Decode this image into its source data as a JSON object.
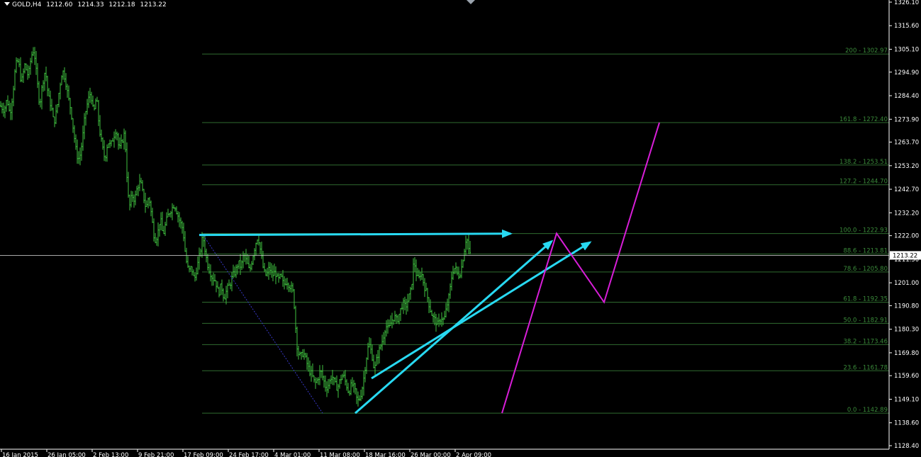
{
  "header": {
    "symbol": "GOLD,H4",
    "open": "1212.60",
    "high": "1214.33",
    "low": "1212.18",
    "close": "1213.22"
  },
  "current_price_label": "1213.22",
  "colors": {
    "background": "#000000",
    "axis": "#ffffff",
    "candles": "#3fc23f",
    "fib": "#2f6b2f",
    "fib_text": "#3a8a3a",
    "arrows": "#28d9f2",
    "projection": "#d81ed8",
    "trend_dotted": "#3838c8",
    "current_line": "#c0c0c0"
  },
  "chart_data": {
    "type": "candlestick",
    "y_axis": {
      "ylim": [
        1124.9,
        1328.8
      ],
      "ticks": [
        "1326.10",
        "1315.60",
        "1305.10",
        "1294.90",
        "1284.40",
        "1273.90",
        "1263.70",
        "1253.20",
        "1242.70",
        "1232.20",
        "1222.00",
        "1211.50",
        "1201.00",
        "1190.80",
        "1180.30",
        "1169.80",
        "1159.60",
        "1149.10",
        "1138.60",
        "1128.40"
      ]
    },
    "x_axis": {
      "ticks": [
        "16 Jan 2015",
        "26 Jan 05:00",
        "2 Feb 13:00",
        "9 Feb 21:00",
        "17 Feb 09:00",
        "24 Feb 17:00",
        "4 Mar 01:00",
        "11 Mar 08:00",
        "18 Mar 16:00",
        "26 Mar 00:00",
        "2 Apr 09:00"
      ]
    },
    "price_path": [
      [
        0,
        1280
      ],
      [
        6,
        1278
      ],
      [
        10,
        1283
      ],
      [
        14,
        1276
      ],
      [
        18,
        1285
      ],
      [
        22,
        1298
      ],
      [
        26,
        1300
      ],
      [
        30,
        1290
      ],
      [
        35,
        1298
      ],
      [
        40,
        1293
      ],
      [
        44,
        1302
      ],
      [
        48,
        1305
      ],
      [
        52,
        1292
      ],
      [
        56,
        1280
      ],
      [
        60,
        1290
      ],
      [
        64,
        1296
      ],
      [
        68,
        1284
      ],
      [
        72,
        1280
      ],
      [
        76,
        1272
      ],
      [
        80,
        1278
      ],
      [
        84,
        1288
      ],
      [
        88,
        1296
      ],
      [
        92,
        1292
      ],
      [
        96,
        1284
      ],
      [
        100,
        1278
      ],
      [
        104,
        1268
      ],
      [
        108,
        1258
      ],
      [
        112,
        1256
      ],
      [
        116,
        1264
      ],
      [
        120,
        1276
      ],
      [
        124,
        1282
      ],
      [
        128,
        1286
      ],
      [
        132,
        1276
      ],
      [
        136,
        1284
      ],
      [
        140,
        1270
      ],
      [
        144,
        1262
      ],
      [
        148,
        1256
      ],
      [
        152,
        1264
      ],
      [
        156,
        1262
      ],
      [
        160,
        1266
      ],
      [
        164,
        1270
      ],
      [
        168,
        1260
      ],
      [
        172,
        1264
      ],
      [
        176,
        1268
      ],
      [
        178,
        1254
      ],
      [
        180,
        1244
      ],
      [
        182,
        1234
      ],
      [
        186,
        1240
      ],
      [
        190,
        1238
      ],
      [
        194,
        1244
      ],
      [
        198,
        1246
      ],
      [
        202,
        1240
      ],
      [
        206,
        1234
      ],
      [
        210,
        1240
      ],
      [
        214,
        1230
      ],
      [
        218,
        1220
      ],
      [
        222,
        1222
      ],
      [
        226,
        1230
      ],
      [
        230,
        1222
      ],
      [
        234,
        1228
      ],
      [
        238,
        1232
      ],
      [
        242,
        1234
      ],
      [
        246,
        1236
      ],
      [
        250,
        1232
      ],
      [
        254,
        1228
      ],
      [
        258,
        1225
      ],
      [
        262,
        1212
      ],
      [
        266,
        1206
      ],
      [
        270,
        1208
      ],
      [
        274,
        1202
      ],
      [
        278,
        1208
      ],
      [
        282,
        1214
      ],
      [
        286,
        1222
      ],
      [
        288,
        1218
      ],
      [
        292,
        1210
      ],
      [
        296,
        1206
      ],
      [
        300,
        1203
      ],
      [
        304,
        1202
      ],
      [
        308,
        1196
      ],
      [
        312,
        1200
      ],
      [
        316,
        1194
      ],
      [
        320,
        1198
      ],
      [
        324,
        1200
      ],
      [
        328,
        1204
      ],
      [
        332,
        1206
      ],
      [
        336,
        1210
      ],
      [
        340,
        1208
      ],
      [
        344,
        1214
      ],
      [
        348,
        1210
      ],
      [
        352,
        1206
      ],
      [
        356,
        1212
      ],
      [
        360,
        1218
      ],
      [
        364,
        1222
      ],
      [
        368,
        1214
      ],
      [
        372,
        1206
      ],
      [
        376,
        1204
      ],
      [
        380,
        1208
      ],
      [
        384,
        1204
      ],
      [
        388,
        1206
      ],
      [
        392,
        1202
      ],
      [
        396,
        1204
      ],
      [
        400,
        1200
      ],
      [
        404,
        1202
      ],
      [
        408,
        1200
      ],
      [
        412,
        1198
      ],
      [
        414,
        1196
      ],
      [
        416,
        1186
      ],
      [
        418,
        1176
      ],
      [
        420,
        1170
      ],
      [
        424,
        1168
      ],
      [
        428,
        1170
      ],
      [
        432,
        1166
      ],
      [
        436,
        1162
      ],
      [
        440,
        1160
      ],
      [
        444,
        1156
      ],
      [
        448,
        1158
      ],
      [
        452,
        1162
      ],
      [
        456,
        1158
      ],
      [
        460,
        1154
      ],
      [
        464,
        1156
      ],
      [
        468,
        1160
      ],
      [
        472,
        1156
      ],
      [
        476,
        1154
      ],
      [
        480,
        1158
      ],
      [
        484,
        1160
      ],
      [
        488,
        1156
      ],
      [
        492,
        1152
      ],
      [
        496,
        1156
      ],
      [
        500,
        1154
      ],
      [
        504,
        1148
      ],
      [
        508,
        1150
      ],
      [
        512,
        1156
      ],
      [
        516,
        1166
      ],
      [
        520,
        1174
      ],
      [
        524,
        1170
      ],
      [
        528,
        1162
      ],
      [
        532,
        1168
      ],
      [
        536,
        1172
      ],
      [
        540,
        1176
      ],
      [
        544,
        1182
      ],
      [
        548,
        1180
      ],
      [
        552,
        1184
      ],
      [
        556,
        1186
      ],
      [
        560,
        1184
      ],
      [
        564,
        1188
      ],
      [
        568,
        1192
      ],
      [
        572,
        1190
      ],
      [
        576,
        1194
      ],
      [
        580,
        1198
      ],
      [
        584,
        1212
      ],
      [
        586,
        1206
      ],
      [
        590,
        1202
      ],
      [
        594,
        1206
      ],
      [
        598,
        1200
      ],
      [
        602,
        1196
      ],
      [
        606,
        1190
      ],
      [
        610,
        1186
      ],
      [
        614,
        1184
      ],
      [
        618,
        1182
      ],
      [
        622,
        1186
      ],
      [
        626,
        1184
      ],
      [
        630,
        1190
      ],
      [
        634,
        1196
      ],
      [
        638,
        1206
      ],
      [
        642,
        1208
      ],
      [
        646,
        1204
      ],
      [
        650,
        1206
      ],
      [
        652,
        1210
      ],
      [
        654,
        1214
      ],
      [
        656,
        1218
      ],
      [
        658,
        1222
      ],
      [
        660,
        1218
      ],
      [
        662,
        1214
      ],
      [
        664,
        1213
      ]
    ],
    "fibonacci_levels": [
      {
        "level": "0.0",
        "price": 1142.89,
        "label": "0.0 - 1142.89"
      },
      {
        "level": "23.6",
        "price": 1161.78,
        "label": "23.6 - 1161.78"
      },
      {
        "level": "38.2",
        "price": 1173.46,
        "label": "38.2 - 1173.46"
      },
      {
        "level": "50.0",
        "price": 1182.91,
        "label": "50.0 - 1182.91"
      },
      {
        "level": "61.8",
        "price": 1192.35,
        "label": "61.8 - 1192.35"
      },
      {
        "level": "78.6",
        "price": 1205.8,
        "label": "78.6 - 1205.80"
      },
      {
        "level": "88.6",
        "price": 1213.81,
        "label": "88.6 - 1213.81"
      },
      {
        "level": "100.0",
        "price": 1222.93,
        "label": "100.0 - 1222.93"
      },
      {
        "level": "127.2",
        "price": 1244.7,
        "label": "127.2 - 1244.70"
      },
      {
        "level": "138.2",
        "price": 1253.51,
        "label": "138.2 - 1253.51"
      },
      {
        "level": "161.8",
        "price": 1272.4,
        "label": "161.8 - 1272.40"
      },
      {
        "level": "200",
        "price": 1302.97,
        "label": "200 - 1302.97"
      }
    ],
    "current_price": 1213.22
  }
}
